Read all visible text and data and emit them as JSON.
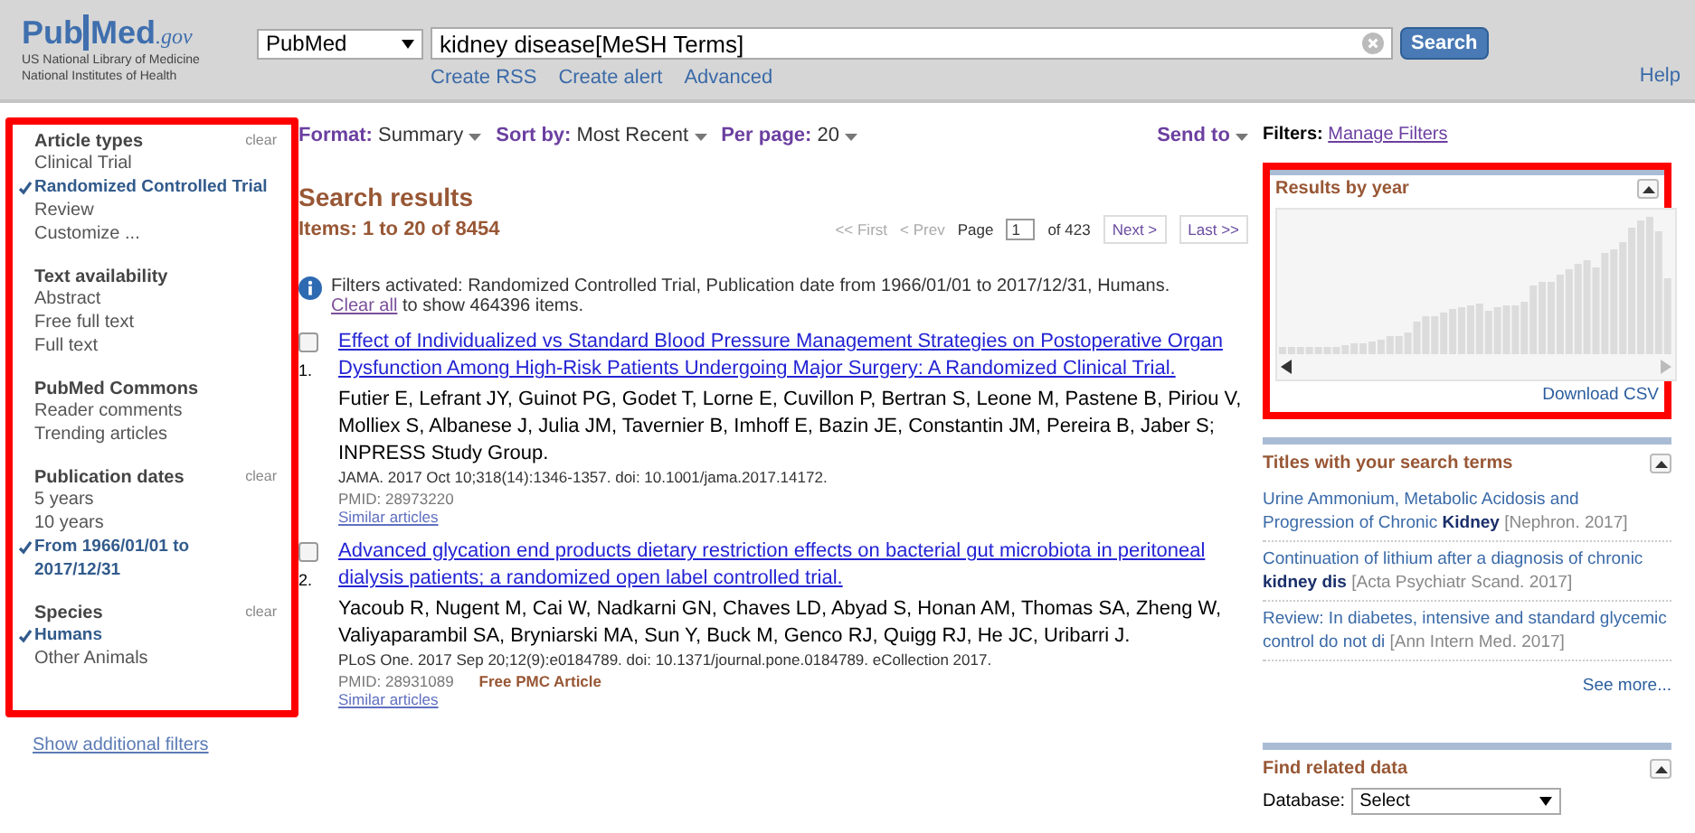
{
  "header": {
    "logo": {
      "brand_a": "Pub",
      "brand_b": "Med",
      "suffix": ".gov",
      "line1": "US National Library of Medicine",
      "line2": "National Institutes of Health"
    },
    "database": "PubMed",
    "query": "kidney disease[MeSH Terms]",
    "search_button": "Search",
    "links": [
      "Create RSS",
      "Create alert",
      "Advanced"
    ],
    "help": "Help"
  },
  "sidebar": {
    "highlighted": true,
    "groups": [
      {
        "title": "Article types",
        "clear": "clear",
        "items": [
          {
            "label": "Clinical Trial",
            "selected": false
          },
          {
            "label": "Randomized Controlled Trial",
            "selected": true
          },
          {
            "label": "Review",
            "selected": false
          },
          {
            "label": "Customize ...",
            "selected": false
          }
        ]
      },
      {
        "title": "Text availability",
        "items": [
          {
            "label": "Abstract",
            "selected": false
          },
          {
            "label": "Free full text",
            "selected": false
          },
          {
            "label": "Full text",
            "selected": false
          }
        ]
      },
      {
        "title": "PubMed Commons",
        "items": [
          {
            "label": "Reader comments",
            "selected": false
          },
          {
            "label": "Trending articles",
            "selected": false
          }
        ]
      },
      {
        "title": "Publication dates",
        "clear": "clear",
        "items": [
          {
            "label": "5 years",
            "selected": false
          },
          {
            "label": "10 years",
            "selected": false
          },
          {
            "label": "From 1966/01/01 to 2017/12/31",
            "selected": true
          }
        ]
      },
      {
        "title": "Species",
        "clear": "clear",
        "items": [
          {
            "label": "Humans",
            "selected": true
          },
          {
            "label": "Other Animals",
            "selected": false
          }
        ]
      }
    ],
    "show_filters": "Show additional filters"
  },
  "toolbar": {
    "controls": [
      {
        "label": "Format:",
        "value": "Summary"
      },
      {
        "label": "Sort by:",
        "value": "Most Recent"
      },
      {
        "label": "Per page:",
        "value": "20"
      }
    ],
    "send_to": "Send to"
  },
  "results": {
    "heading": "Search results",
    "count": "Items: 1 to 20 of 8454",
    "pager": {
      "first": "<< First",
      "prev": "< Prev",
      "page_label": "Page",
      "page": "1",
      "of": "of 423",
      "next": "Next >",
      "last": "Last >>"
    },
    "notice": {
      "text": "Filters activated: Randomized Controlled Trial, Publication date from 1966/01/01 to 2017/12/31, Humans.",
      "link": "Clear all",
      "after": "to show 464396 items."
    },
    "items": [
      {
        "number": "1.",
        "checked": false,
        "title": "Effect of Individualized vs Standard Blood Pressure Management Strategies on Postoperative Organ Dysfunction Among High-Risk Patients Undergoing Major Surgery: A Randomized Clinical Trial.",
        "authors": "Futier E, Lefrant JY, Guinot PG, Godet T, Lorne E, Cuvillon P, Bertran S, Leone M, Pastene B, Piriou V, Molliex S, Albanese J, Julia JM, Tavernier B, Imhoff E, Bazin JE, Constantin JM, Pereira B, Jaber S; INPRESS Study Group.",
        "citation": "JAMA. 2017 Oct 10;318(14):1346-1357. doi: 10.1001/jama.2017.14172.",
        "pmid": "PMID: 28973220",
        "similar": "Similar articles"
      },
      {
        "number": "2.",
        "checked": false,
        "title": "Advanced glycation end products dietary restriction effects on bacterial gut microbiota in peritoneal dialysis patients; a randomized open label controlled trial.",
        "authors": "Yacoub R, Nugent M, Cai W, Nadkarni GN, Chaves LD, Abyad S, Honan AM, Thomas SA, Zheng W, Valiyaparambil SA, Bryniarski MA, Sun Y, Buck M, Genco RJ, Quigg RJ, He JC, Uribarri J.",
        "citation": "PLoS One. 2017 Sep 20;12(9):e0184789. doi: 10.1371/journal.pone.0184789. eCollection 2017.",
        "pmid": "PMID: 28931089",
        "free": "Free PMC Article",
        "similar": "Similar articles"
      }
    ]
  },
  "right": {
    "filters_label": "Filters:",
    "manage": "Manage Filters",
    "year_panel": {
      "title": "Results by year",
      "highlighted": true,
      "download": "Download CSV"
    },
    "titles_panel": {
      "title": "Titles with your search terms",
      "items": [
        {
          "title": "Urine Ammonium, Metabolic Acidosis and Progression of Chronic **Kidney**",
          "source": "[Nephron. 2017]"
        },
        {
          "title": "Continuation of lithium after a diagnosis of chronic **kidney dis**",
          "source": "[Acta Psychiatr Scand. 2017]"
        },
        {
          "title": "Review: In diabetes, intensive and standard glycemic control do not di",
          "source": "[Ann Intern Med. 2017]"
        }
      ],
      "more": "See more..."
    },
    "related_panel": {
      "title": "Find related data",
      "database_label": "Database:",
      "select": "Select"
    }
  }
}
